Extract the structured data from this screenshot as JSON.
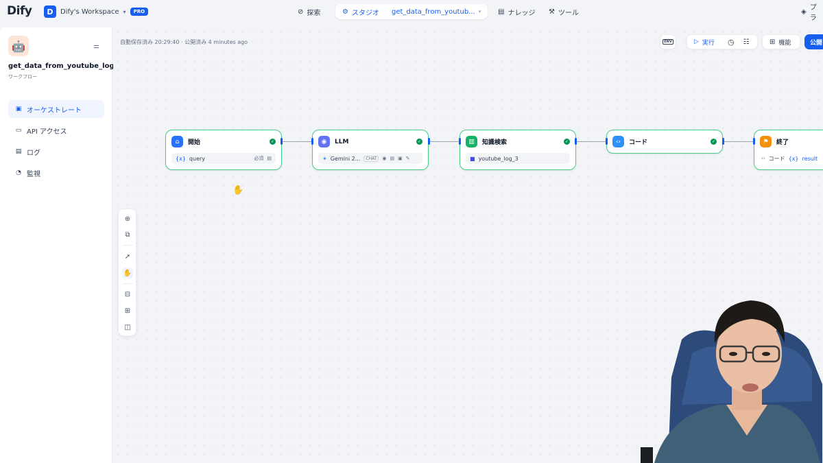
{
  "brand": {
    "logo": "Dify",
    "workspace_initial": "D",
    "workspace_name": "Dify's Workspace",
    "plan_badge": "PRO"
  },
  "nav": {
    "explore": "探索",
    "studio": "スタジオ",
    "current_app": "get_data_from_youtub...",
    "knowledge": "ナレッジ",
    "tools": "ツール",
    "plugins": "プラ"
  },
  "app": {
    "name": "get_data_from_youtube_log",
    "type": "ワークフロー",
    "menu": [
      {
        "label": "オーケストレート",
        "icon": "layout-icon",
        "active": true
      },
      {
        "label": "API アクセス",
        "icon": "terminal-icon",
        "active": false
      },
      {
        "label": "ログ",
        "icon": "file-icon",
        "active": false
      },
      {
        "label": "監視",
        "icon": "monitor-icon",
        "active": false
      }
    ]
  },
  "toolbar": {
    "save_status": "自動保存済み 20:29:40 · 公開済み 4 minutes ago",
    "env_label": "ENV",
    "run_label": "実行",
    "features_label": "機能",
    "publish_label": "公開"
  },
  "nodes": {
    "start": {
      "title": "開始",
      "var_symbol": "{x}",
      "var": "query",
      "required": "必須"
    },
    "llm": {
      "title": "LLM",
      "model": "Gemini 2...",
      "mode": "CHAT"
    },
    "knowledge": {
      "title": "知識検索",
      "dataset": "youtube_log_3"
    },
    "code": {
      "title": "コード"
    },
    "end": {
      "title": "終了",
      "source": "コード",
      "var_symbol": "{x}",
      "var": "result"
    }
  },
  "colors": {
    "accent": "#155eef",
    "node_border": "#47cd89",
    "start_icon": "#2970ff",
    "llm_icon": "#6172f3",
    "knowledge_icon": "#16b364",
    "code_icon": "#2e90fa",
    "end_icon": "#f79009"
  }
}
